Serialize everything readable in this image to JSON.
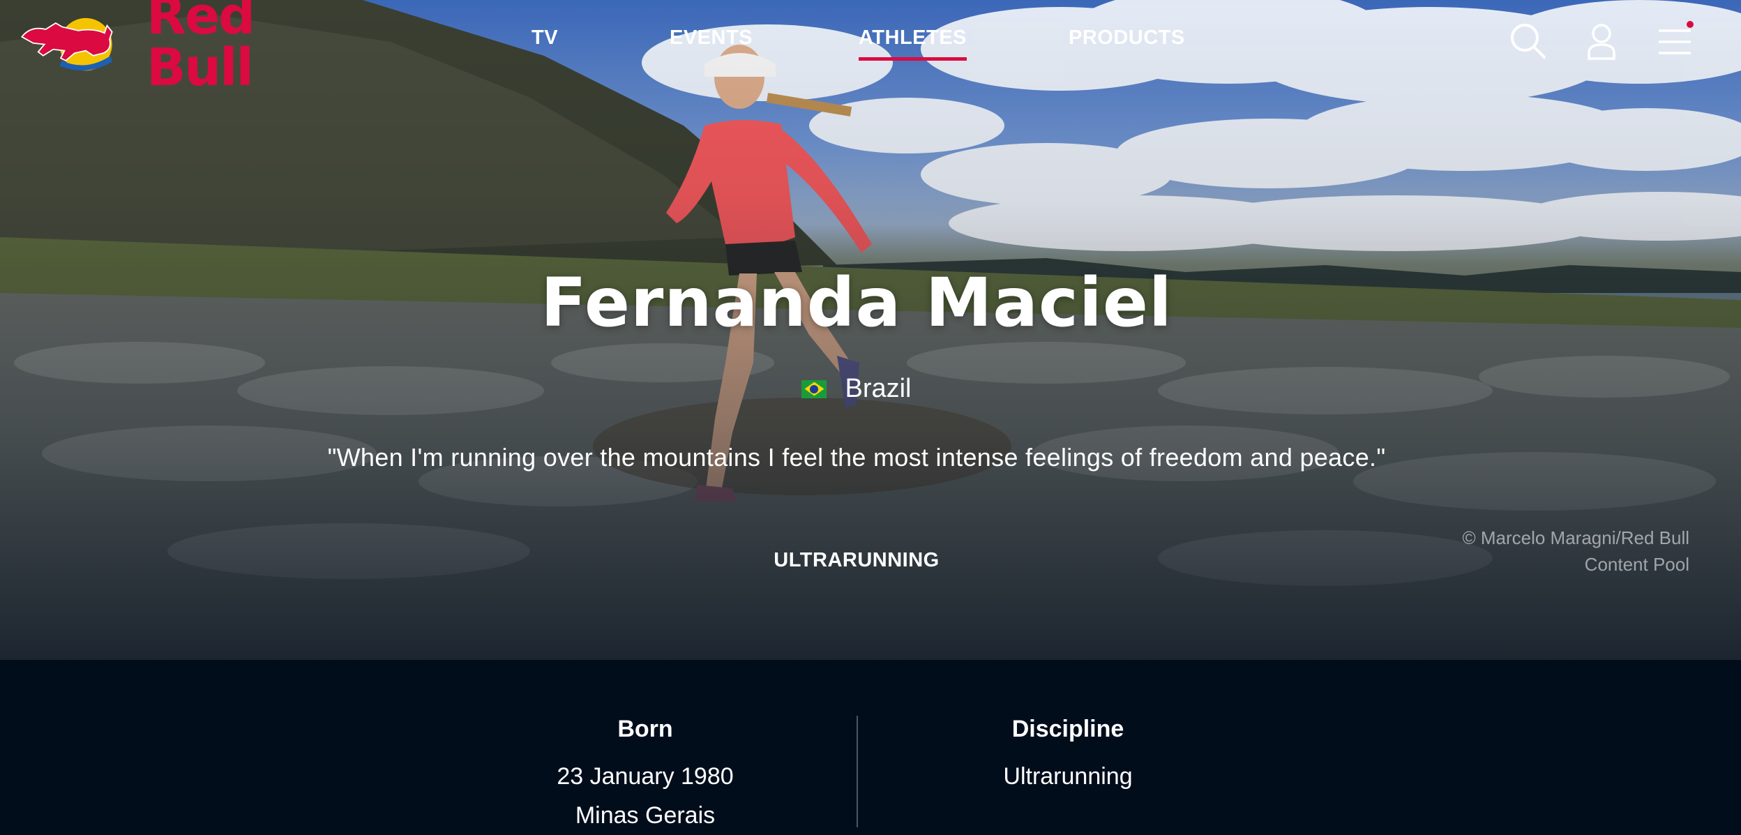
{
  "brand": {
    "name": "Red Bull"
  },
  "nav": {
    "items": [
      {
        "label": "TV",
        "active": false
      },
      {
        "label": "EVENTS",
        "active": false
      },
      {
        "label": "ATHLETES",
        "active": true
      },
      {
        "label": "PRODUCTS",
        "active": false
      }
    ],
    "icons": [
      "search-icon",
      "user-icon",
      "menu-icon"
    ],
    "menu_notification_color": "#db0a40"
  },
  "hero": {
    "athlete_name": "Fernanda Maciel",
    "country": "Brazil",
    "quote": "\"When I'm running over the mountains I feel the most intense feelings of freedom and peace.\"",
    "discipline": "ULTRARUNNING",
    "credit_line1": "© Marcelo Maragni/Red Bull",
    "credit_line2": "Content Pool"
  },
  "info": {
    "born": {
      "title": "Born",
      "date": "23 January 1980",
      "place": "Minas Gerais"
    },
    "discipline": {
      "title": "Discipline",
      "value": "Ultrarunning"
    }
  },
  "colors": {
    "accent": "#db0a40",
    "background": "#020d1c"
  }
}
